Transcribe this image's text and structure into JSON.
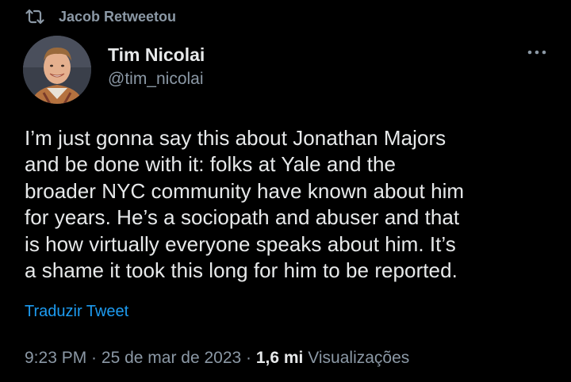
{
  "retweet": {
    "icon": "retweet-icon",
    "label": "Jacob Retweetou"
  },
  "author": {
    "display_name": "Tim Nicolai",
    "handle": "@tim_nicolai",
    "avatar_icon": "avatar-photo"
  },
  "more_icon": "more-options-icon",
  "tweet": {
    "text": "I’m just gonna say this about Jonathan Majors\nand be done with it: folks at Yale and the\nbroader NYC community have known about him\nfor years. He’s a sociopath and abuser and that\nis how virtually everyone speaks about him. It’s\na shame it took this long for him to be reported.",
    "translate_label": "Traduzir Tweet"
  },
  "meta": {
    "time": "9:23 PM",
    "separator": " · ",
    "date": "25 de mar de 2023",
    "views_count": "1,6 mi",
    "views_label": "Visualizações"
  },
  "colors": {
    "background": "#000000",
    "primary_text": "#e7e9ea",
    "secondary_text": "#8b98a5",
    "link": "#1d9bf0"
  }
}
